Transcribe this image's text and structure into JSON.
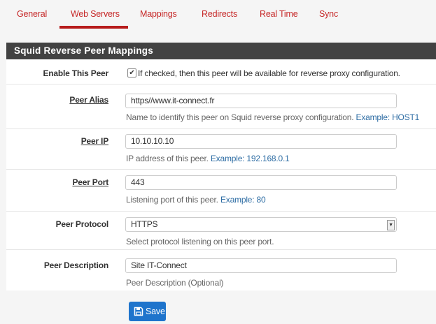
{
  "tabs": [
    {
      "label": "General"
    },
    {
      "label": "Web Servers",
      "active": true
    },
    {
      "label": "Mappings"
    },
    {
      "label": "Redirects"
    },
    {
      "label": "Real Time"
    },
    {
      "label": "Sync"
    }
  ],
  "panel_title": "Squid Reverse Peer Mappings",
  "enable": {
    "label": "Enable This Peer",
    "checked": true,
    "text": "If checked, then this peer will be available for reverse proxy configuration."
  },
  "alias": {
    "label": "Peer Alias",
    "value": "https//www.it-connect.fr",
    "help": "Name to identify this peer on Squid reverse proxy configuration.",
    "example": "Example: HOST1"
  },
  "ip": {
    "label": "Peer IP",
    "value": "10.10.10.10",
    "help": "IP address of this peer.",
    "example": "Example: 192.168.0.1"
  },
  "port": {
    "label": "Peer Port",
    "value": "443",
    "help": "Listening port of this peer.",
    "example": "Example: 80"
  },
  "protocol": {
    "label": "Peer Protocol",
    "value": "HTTPS",
    "help": "Select protocol listening on this peer port."
  },
  "description": {
    "label": "Peer Description",
    "value": "Site IT-Connect",
    "help": "Peer Description (Optional)"
  },
  "save_label": "Save",
  "colors": {
    "tab": "#c62828",
    "header": "#424242",
    "button": "#1e74cc",
    "link": "#2e6da4"
  }
}
